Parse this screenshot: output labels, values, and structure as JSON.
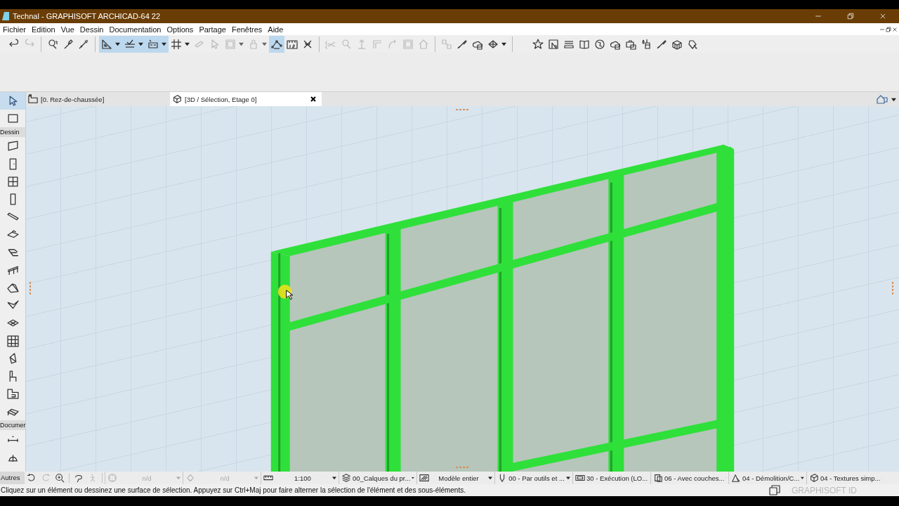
{
  "window": {
    "title": "Technal - GRAPHISOFT ARCHICAD-64 22"
  },
  "menu": [
    "Fichier",
    "Edition",
    "Vue",
    "Dessin",
    "Documentation",
    "Options",
    "Partage",
    "Fenêtres",
    "Aide"
  ],
  "toolbar_groups": [
    {
      "buttons": [
        {
          "selected": false,
          "disabled": false,
          "dropdown": false
        },
        {
          "selected": false,
          "disabled": true,
          "dropdown": false
        }
      ]
    },
    {
      "buttons": [
        {
          "selected": false,
          "disabled": false,
          "dropdown": false
        },
        {
          "selected": false,
          "disabled": false,
          "dropdown": false
        },
        {
          "selected": false,
          "disabled": false,
          "dropdown": false
        }
      ]
    },
    {
      "buttons": [
        {
          "selected": true,
          "disabled": false,
          "dropdown": true
        },
        {
          "selected": true,
          "disabled": false,
          "dropdown": true
        },
        {
          "selected": true,
          "disabled": false,
          "dropdown": true
        },
        {
          "selected": false,
          "disabled": false,
          "dropdown": true
        },
        {
          "selected": false,
          "disabled": true,
          "dropdown": false
        },
        {
          "selected": false,
          "disabled": true,
          "dropdown": false
        },
        {
          "selected": false,
          "disabled": true,
          "dropdown": true
        },
        {
          "selected": false,
          "disabled": true,
          "dropdown": true
        },
        {
          "selected": true,
          "disabled": false,
          "dropdown": false
        },
        {
          "selected": false,
          "disabled": false,
          "dropdown": false
        },
        {
          "selected": false,
          "disabled": false,
          "dropdown": false
        }
      ]
    },
    {
      "buttons": [
        {
          "selected": false,
          "disabled": true,
          "dropdown": false
        },
        {
          "selected": false,
          "disabled": true,
          "dropdown": false
        },
        {
          "selected": false,
          "disabled": true,
          "dropdown": false
        },
        {
          "selected": false,
          "disabled": true,
          "dropdown": false
        },
        {
          "selected": false,
          "disabled": true,
          "dropdown": false
        },
        {
          "selected": false,
          "disabled": true,
          "dropdown": false
        },
        {
          "selected": false,
          "disabled": true,
          "dropdown": false
        }
      ]
    },
    {
      "buttons": [
        {
          "selected": false,
          "disabled": true,
          "dropdown": false
        },
        {
          "selected": false,
          "disabled": false,
          "dropdown": false
        },
        {
          "selected": false,
          "disabled": false,
          "dropdown": false
        },
        {
          "selected": false,
          "disabled": false,
          "dropdown": true
        }
      ]
    },
    {
      "buttons": [
        {
          "selected": false,
          "disabled": false,
          "dropdown": false
        },
        {
          "selected": false,
          "disabled": false,
          "dropdown": false
        },
        {
          "selected": false,
          "disabled": false,
          "dropdown": false
        },
        {
          "selected": false,
          "disabled": false,
          "dropdown": false
        },
        {
          "selected": false,
          "disabled": false,
          "dropdown": false
        },
        {
          "selected": false,
          "disabled": false,
          "dropdown": false
        },
        {
          "selected": false,
          "disabled": false,
          "dropdown": false
        },
        {
          "selected": false,
          "disabled": false,
          "dropdown": false
        },
        {
          "selected": false,
          "disabled": false,
          "dropdown": false
        },
        {
          "selected": false,
          "disabled": false,
          "dropdown": false
        },
        {
          "selected": false,
          "disabled": false,
          "dropdown": false
        }
      ]
    }
  ],
  "tabs": [
    {
      "label": "[0. Rez-de-chaussée]",
      "selected": false
    },
    {
      "label": "[3D / Sélection, Etage 0]",
      "selected": true
    }
  ],
  "toolbox": [
    {
      "kind": "tool",
      "selected": true
    },
    {
      "kind": "tool",
      "selected": false
    },
    {
      "kind": "header",
      "label": "Dessin"
    },
    {
      "kind": "tool",
      "selected": false
    },
    {
      "kind": "tool",
      "selected": false
    },
    {
      "kind": "tool",
      "selected": false
    },
    {
      "kind": "tool",
      "selected": false
    },
    {
      "kind": "tool",
      "selected": false
    },
    {
      "kind": "tool",
      "selected": false
    },
    {
      "kind": "tool",
      "selected": false
    },
    {
      "kind": "tool",
      "selected": false
    },
    {
      "kind": "tool",
      "selected": false
    },
    {
      "kind": "tool",
      "selected": false
    },
    {
      "kind": "tool",
      "selected": false
    },
    {
      "kind": "tool",
      "selected": false
    },
    {
      "kind": "tool",
      "selected": false
    },
    {
      "kind": "tool",
      "selected": false
    },
    {
      "kind": "tool",
      "selected": false
    },
    {
      "kind": "tool",
      "selected": false
    },
    {
      "kind": "header",
      "label": "Documer"
    },
    {
      "kind": "tool",
      "selected": false
    },
    {
      "kind": "tool",
      "selected": false
    }
  ],
  "nav_bar": {
    "label": "Autres",
    "buttons": [
      {
        "disabled": false
      },
      {
        "disabled": true
      },
      {
        "disabled": false
      },
      {
        "disabled": false
      },
      {
        "disabled": true
      }
    ],
    "fields": [
      {
        "text": "n/d",
        "disabled": true
      },
      {
        "text": "n/d",
        "disabled": true
      },
      {
        "text": "1:100",
        "disabled": false
      },
      {
        "text": "00_Calques du pr...",
        "disabled": false
      },
      {
        "text": "Modèle entier",
        "disabled": false
      },
      {
        "text": "00 - Par outils et ...",
        "disabled": false
      },
      {
        "text": "30 - Exécution (LO...",
        "disabled": false
      },
      {
        "text": "06 - Avec couches...",
        "disabled": false
      },
      {
        "text": "04 - Démolition/C...",
        "disabled": false
      },
      {
        "text": "04 - Textures simp...",
        "disabled": false
      }
    ]
  },
  "status_bar": {
    "message": "Cliquez sur un élément ou dessinez une surface de sélection. Appuyez sur Ctrl+Maj pour faire alterner la sélection de l'élément et des sous-éléments.",
    "account": "GRAPHISOFT ID"
  }
}
